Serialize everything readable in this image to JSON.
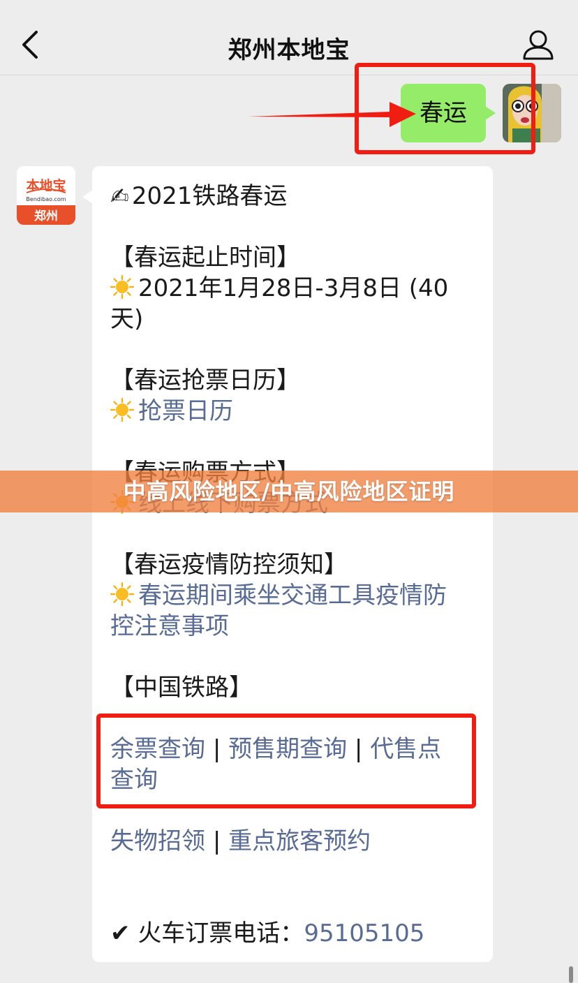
{
  "header": {
    "title": "郑州本地宝",
    "back_icon": "chevron-left-icon",
    "profile_icon": "user-icon"
  },
  "outgoing_message": {
    "text": "春运"
  },
  "account_logo": {
    "brand_cn": "本地宝",
    "brand_en": "Bendibao.com",
    "city": "郑州",
    "color": "#e8502a"
  },
  "reply": {
    "title": "2021铁路春运",
    "sections": [
      {
        "heading": "【春运起止时间】",
        "line1": "2021年1月28日-3月8日 (40",
        "line2": "天)"
      },
      {
        "heading": "【春运抢票日历】",
        "link": "抢票日历"
      },
      {
        "heading": "【春运购票方式】",
        "link": "线上线下购票方式"
      },
      {
        "heading": "【春运疫情防控须知】",
        "link_line1": "春运期间乘坐交通工具疫情防",
        "link_line2": "控注意事项"
      },
      {
        "heading": "【中国铁路】"
      }
    ],
    "railway_links_row1": [
      "余票查询",
      "预售期查询",
      "代售点"
    ],
    "railway_links_row1_tail": "查询",
    "railway_links_row2": [
      "失物招领",
      "重点旅客预约"
    ],
    "separator": "|",
    "phone_label": "火车订票电话：",
    "phone_number": "95105105"
  },
  "banner": {
    "text": "中高风险地区/中高风险地区证明"
  },
  "colors": {
    "bubble_out": "#95ec69",
    "link": "#576b95",
    "highlight": "#f01e12",
    "banner": "#f08040"
  }
}
